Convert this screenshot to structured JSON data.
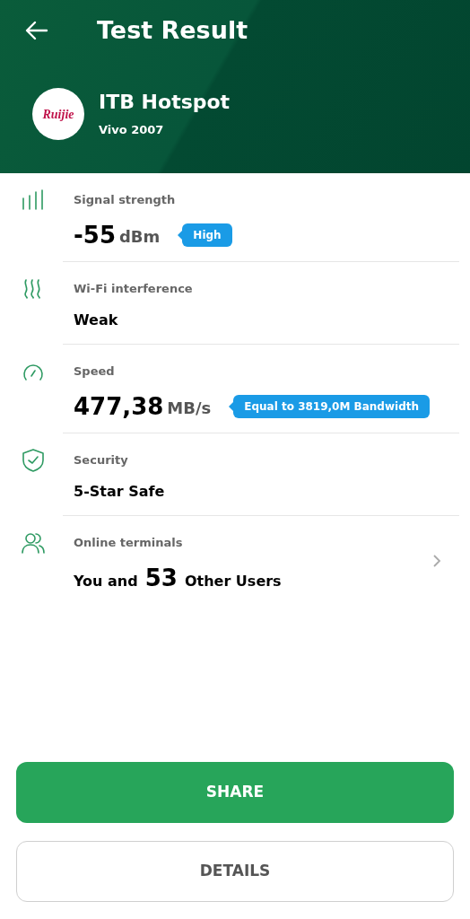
{
  "header": {
    "title": "Test Result",
    "network": {
      "logo": "Ruijie",
      "name": "ITB Hotspot",
      "subtitle": "Vivo 2007"
    }
  },
  "items": [
    {
      "kind": "signal",
      "label": "Signal strength",
      "value": "-55",
      "unit": "dBm",
      "tag": "High"
    },
    {
      "kind": "interference",
      "label": "Wi-Fi interference",
      "value": "Weak"
    },
    {
      "kind": "speed",
      "label": "Speed",
      "value": "477,38",
      "unit": "MB/s",
      "tag": "Equal to 3819,0M Bandwidth"
    },
    {
      "kind": "security",
      "label": "Security",
      "value": "5-Star Safe"
    },
    {
      "kind": "terminals",
      "label": "Online terminals",
      "prefix": "You and",
      "count": "53",
      "suffix": "Other Users"
    }
  ],
  "buttons": [
    {
      "kind": "primary",
      "label": "SHARE"
    },
    {
      "kind": "secondary",
      "label": "DETAILS"
    }
  ]
}
